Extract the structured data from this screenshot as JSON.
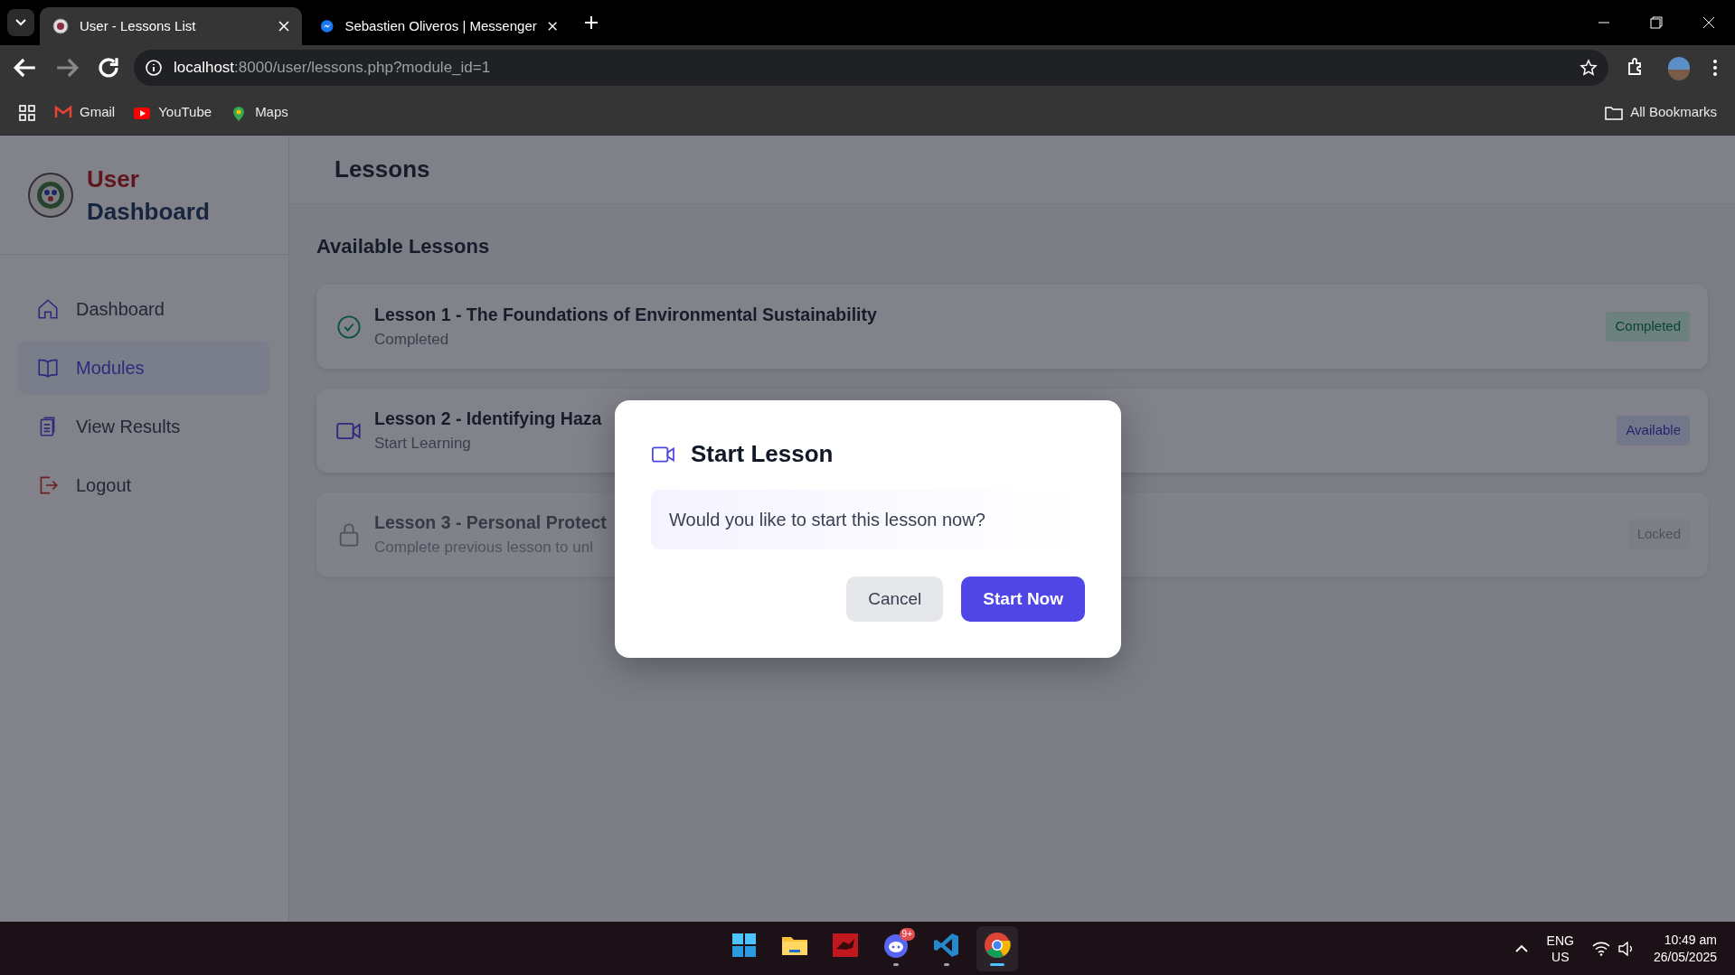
{
  "browser": {
    "tabs": [
      {
        "title": "User - Lessons List",
        "selected": true
      },
      {
        "title": "Sebastien Oliveros | Messenger",
        "selected": false
      }
    ],
    "address": {
      "host": "localhost",
      "path": ":8000/user/lessons.php?module_id=1"
    },
    "bookmarks": [
      {
        "label": "Gmail"
      },
      {
        "label": "YouTube"
      },
      {
        "label": "Maps"
      }
    ],
    "all_bookmarks": "All Bookmarks"
  },
  "sidebar": {
    "brand": {
      "line1": "User",
      "line2": "Dashboard"
    },
    "items": [
      {
        "label": "Dashboard",
        "selected": false
      },
      {
        "label": "Modules",
        "selected": true
      },
      {
        "label": "View Results",
        "selected": false
      },
      {
        "label": "Logout",
        "selected": false
      }
    ]
  },
  "main": {
    "header": "Lessons",
    "section_title": "Available Lessons",
    "lessons": [
      {
        "title": "Lesson 1 - The Foundations of Environmental Sustainability",
        "subtitle": "Completed",
        "kind": "completed",
        "badge": "Completed"
      },
      {
        "title": "Lesson 2 - Identifying Haza",
        "subtitle": "Start Learning",
        "kind": "available",
        "badge": "Available"
      },
      {
        "title": "Lesson 3 - Personal Protect",
        "subtitle": "Complete previous lesson to unl",
        "kind": "locked",
        "badge": "Locked"
      }
    ]
  },
  "modal": {
    "title": "Start Lesson",
    "message": "Would you like to start this lesson now?",
    "buttons": [
      {
        "label": "Cancel",
        "kind": "secondary"
      },
      {
        "label": "Start Now",
        "kind": "primary"
      }
    ]
  },
  "taskbar": {
    "apps": [
      {
        "running": false,
        "active": false
      },
      {
        "running": false,
        "active": false
      },
      {
        "running": false,
        "active": false
      },
      {
        "running": true,
        "active": false,
        "badge": "9+"
      },
      {
        "running": true,
        "active": false
      },
      {
        "running": true,
        "active": true
      }
    ],
    "language": "ENG",
    "region": "US",
    "time": "10:49 am",
    "date": "26/05/2025"
  }
}
